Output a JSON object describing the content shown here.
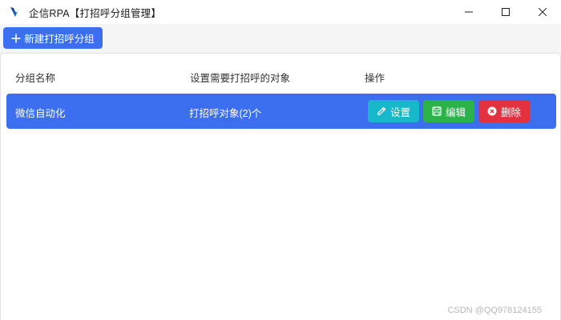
{
  "window": {
    "title": "企信RPA【打招呼分组管理】",
    "controls": [
      "minimize",
      "maximize",
      "close"
    ]
  },
  "toolbar": {
    "new_group_label": "新建打招呼分组"
  },
  "table": {
    "columns": [
      "分组名称",
      "设置需要打招呼的对象",
      "操作"
    ],
    "rows": [
      {
        "name": "微信自动化",
        "targets": "打招呼对象(2)个",
        "actions": [
          "设置",
          "编辑",
          "删除"
        ]
      }
    ]
  },
  "watermark": "CSDN @QQ978124155",
  "colors": {
    "primary": "#3b6ff0",
    "setup": "#17b8c9",
    "edit": "#2bb34a",
    "delete": "#e2323f"
  },
  "icons": {
    "app": "rpa-logo-icon",
    "new": "plus-icon",
    "setup": "pencil-icon",
    "edit": "save-icon",
    "delete": "close-circle-icon"
  }
}
